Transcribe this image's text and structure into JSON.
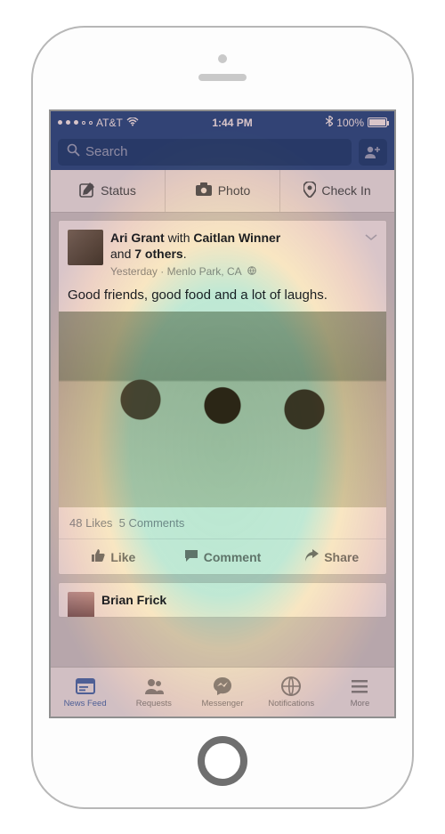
{
  "status": {
    "carrier": "AT&T",
    "time": "1:44 PM",
    "battery_pct": "100%"
  },
  "search": {
    "placeholder": "Search"
  },
  "composer": {
    "status": "Status",
    "photo": "Photo",
    "checkin": "Check In"
  },
  "post": {
    "author": "Ari Grant",
    "with_word": " with ",
    "companion": "Caitlan Winner",
    "and_word": "and ",
    "others": "7 others",
    "period": ".",
    "meta_time": "Yesterday",
    "meta_sep": " · ",
    "meta_loc": "Menlo Park, CA",
    "body": "Good friends, good food and a lot of laughs.",
    "likes": "48 Likes",
    "comments_count": "5 Comments",
    "like_label": "Like",
    "comment_label": "Comment",
    "share_label": "Share"
  },
  "post2": {
    "author": "Brian Frick"
  },
  "tabs": {
    "feed": "News Feed",
    "requests": "Requests",
    "messenger": "Messenger",
    "notifications": "Notifications",
    "more": "More"
  }
}
